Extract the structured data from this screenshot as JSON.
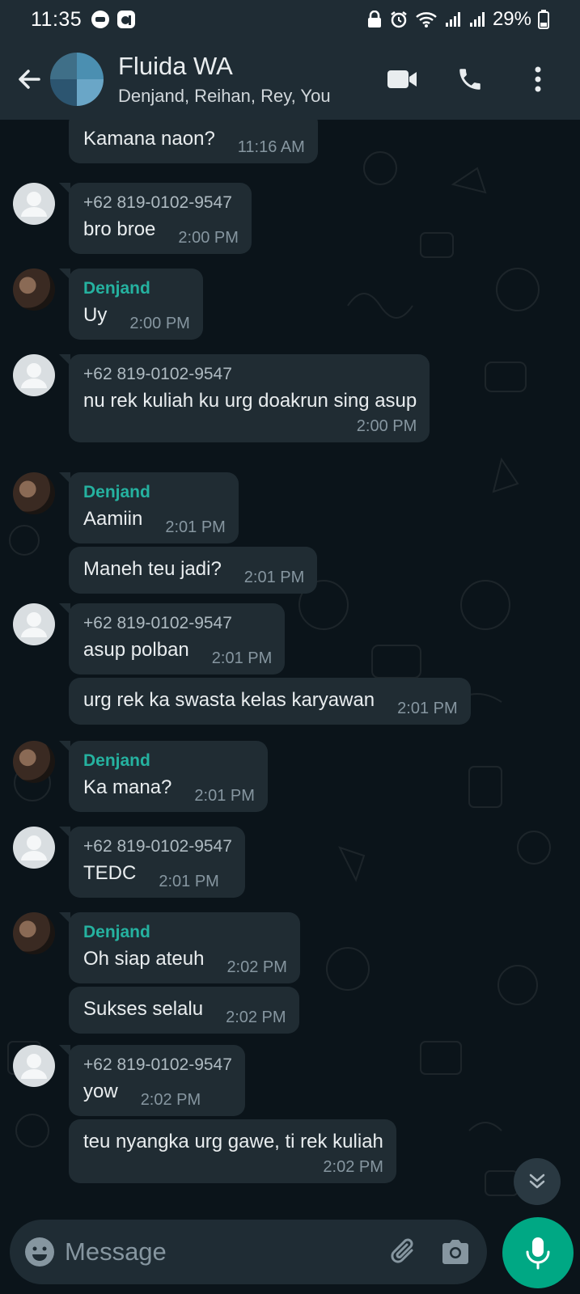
{
  "status_bar": {
    "time": "11:35",
    "battery": "29%"
  },
  "header": {
    "group_name": "Fluida WA",
    "members": "Denjand, Reihan, Rey, You"
  },
  "messages": [
    {
      "sender": "",
      "text": "Kamana naon?",
      "time": "11:16 AM"
    },
    {
      "sender": "+62 819-0102-9547",
      "text": "bro broe",
      "time": "2:00 PM"
    },
    {
      "sender": "Denjand",
      "text": "Uy",
      "time": "2:00 PM"
    },
    {
      "sender": "+62 819-0102-9547",
      "text": "nu rek kuliah ku urg doakrun sing asup",
      "time": "2:00 PM"
    },
    {
      "sender": "Denjand",
      "text": "Aamiin",
      "time": "2:01 PM"
    },
    {
      "sender": "",
      "text": "Maneh teu jadi?",
      "time": "2:01 PM"
    },
    {
      "sender": "+62 819-0102-9547",
      "text": "asup polban",
      "time": "2:01 PM"
    },
    {
      "sender": "",
      "text": "urg rek ka swasta kelas karyawan",
      "time": "2:01 PM"
    },
    {
      "sender": "Denjand",
      "text": "Ka mana?",
      "time": "2:01 PM"
    },
    {
      "sender": "+62 819-0102-9547",
      "text": "TEDC",
      "time": "2:01 PM"
    },
    {
      "sender": "Denjand",
      "text": "Oh siap ateuh",
      "time": "2:02 PM"
    },
    {
      "sender": "",
      "text": "Sukses selalu",
      "time": "2:02 PM"
    },
    {
      "sender": "+62 819-0102-9547",
      "text": "yow",
      "time": "2:02 PM"
    },
    {
      "sender": "",
      "text": "teu nyangka urg gawe, ti rek kuliah",
      "time": "2:02 PM"
    }
  ],
  "input": {
    "placeholder": "Message"
  },
  "colors": {
    "background": "#0b141a",
    "header": "#1f2c34",
    "bubble": "#202c33",
    "accent_green": "#00a884",
    "sender_denjand": "#25b2a0"
  },
  "icons": [
    "back-arrow-icon",
    "video-call-icon",
    "phone-icon",
    "more-vert-icon",
    "emoji-icon",
    "attach-icon",
    "camera-icon",
    "mic-icon",
    "chevron-double-down-icon"
  ]
}
